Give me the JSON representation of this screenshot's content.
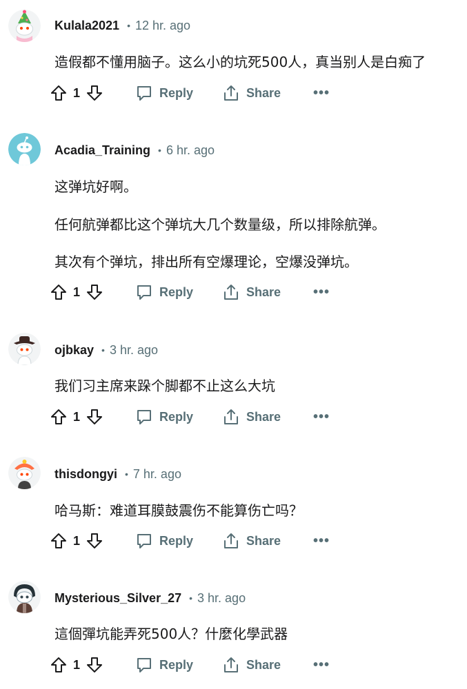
{
  "comments": [
    {
      "username": "Kulala2021",
      "time": "12 hr. ago",
      "lines": [
        "造假都不懂用脑子。这么小的坑死500人，真当别人是白痴了"
      ],
      "score": "1",
      "reply_label": "Reply",
      "share_label": "Share",
      "avatar": "snoo-avatar-green-hat",
      "avatar_color": "#f2f4f5"
    },
    {
      "username": "Acadia_Training",
      "time": "6 hr. ago",
      "lines": [
        "这弹坑好啊。",
        "任何航弹都比这个弹坑大几个数量级，所以排除航弹。",
        "其次有个弹坑，排出所有空爆理论，空爆没弹坑。"
      ],
      "score": "1",
      "reply_label": "Reply",
      "share_label": "Share",
      "avatar": "default-snoo-avatar",
      "avatar_color": "#6fc8d9"
    },
    {
      "username": "ojbkay",
      "time": "3 hr. ago",
      "lines": [
        "我们习主席来跺个脚都不止这么大坑"
      ],
      "score": "1",
      "reply_label": "Reply",
      "share_label": "Share",
      "avatar": "snoo-avatar-cowboy-hat",
      "avatar_color": "#f2f4f5"
    },
    {
      "username": "thisdongyi",
      "time": "7 hr. ago",
      "lines": [
        "哈马斯：难道耳膜鼓震伤不能算伤亡吗？"
      ],
      "score": "1",
      "reply_label": "Reply",
      "share_label": "Share",
      "avatar": "snoo-avatar-orange-hat",
      "avatar_color": "#f2f4f5"
    },
    {
      "username": "Mysterious_Silver_27",
      "time": "3 hr. ago",
      "lines": [
        "這個彈坑能弄死500人？什麼化學武器"
      ],
      "score": "1",
      "reply_label": "Reply",
      "share_label": "Share",
      "avatar": "snoo-avatar-dark-hood",
      "avatar_color": "#f2f4f5"
    }
  ],
  "colors": {
    "text": "#1a1a1b",
    "meta": "#576f76",
    "accent_snoo": "#ff4500"
  }
}
